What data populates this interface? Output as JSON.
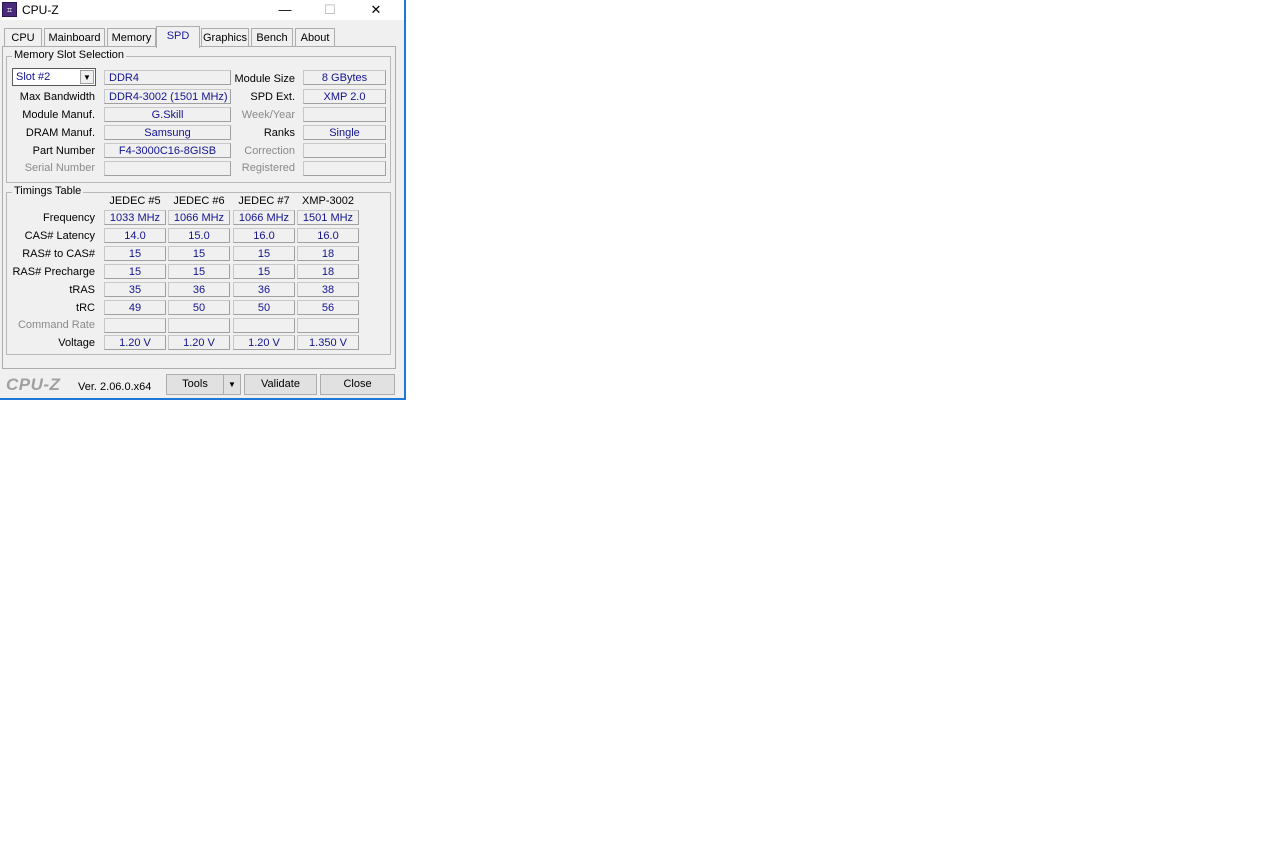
{
  "window": {
    "title": "CPU-Z",
    "icon_label": "⌗",
    "minimize": "—",
    "maximize": "☐",
    "close": "✕"
  },
  "tabs": [
    {
      "label": "CPU",
      "active": false
    },
    {
      "label": "Mainboard",
      "active": false
    },
    {
      "label": "Memory",
      "active": false
    },
    {
      "label": "SPD",
      "active": true
    },
    {
      "label": "Graphics",
      "active": false
    },
    {
      "label": "Bench",
      "active": false
    },
    {
      "label": "About",
      "active": false
    }
  ],
  "memory_slot": {
    "group_title": "Memory Slot Selection",
    "slot": "Slot #2",
    "type": "DDR4",
    "labels": {
      "max_bandwidth": "Max Bandwidth",
      "module_manuf": "Module Manuf.",
      "dram_manuf": "DRAM Manuf.",
      "part_number": "Part Number",
      "serial_number": "Serial Number",
      "module_size": "Module Size",
      "spd_ext": "SPD Ext.",
      "week_year": "Week/Year",
      "ranks": "Ranks",
      "correction": "Correction",
      "registered": "Registered"
    },
    "values": {
      "max_bandwidth": "DDR4-3002 (1501 MHz)",
      "module_manuf": "G.Skill",
      "dram_manuf": "Samsung",
      "part_number": "F4-3000C16-8GISB",
      "serial_number": "",
      "module_size": "8 GBytes",
      "spd_ext": "XMP 2.0",
      "week_year": "",
      "ranks": "Single",
      "correction": "",
      "registered": ""
    }
  },
  "timings": {
    "group_title": "Timings Table",
    "columns": [
      "JEDEC #5",
      "JEDEC #6",
      "JEDEC #7",
      "XMP-3002"
    ],
    "rows": [
      {
        "label": "Frequency",
        "disabled": false,
        "values": [
          "1033 MHz",
          "1066 MHz",
          "1066 MHz",
          "1501 MHz"
        ]
      },
      {
        "label": "CAS# Latency",
        "disabled": false,
        "values": [
          "14.0",
          "15.0",
          "16.0",
          "16.0"
        ]
      },
      {
        "label": "RAS# to CAS#",
        "disabled": false,
        "values": [
          "15",
          "15",
          "15",
          "18"
        ]
      },
      {
        "label": "RAS# Precharge",
        "disabled": false,
        "values": [
          "15",
          "15",
          "15",
          "18"
        ]
      },
      {
        "label": "tRAS",
        "disabled": false,
        "values": [
          "35",
          "36",
          "36",
          "38"
        ]
      },
      {
        "label": "tRC",
        "disabled": false,
        "values": [
          "49",
          "50",
          "50",
          "56"
        ]
      },
      {
        "label": "Command Rate",
        "disabled": true,
        "values": [
          "",
          "",
          "",
          ""
        ]
      },
      {
        "label": "Voltage",
        "disabled": false,
        "values": [
          "1.20 V",
          "1.20 V",
          "1.20 V",
          "1.350 V"
        ]
      }
    ]
  },
  "footer": {
    "logo": "CPU-Z",
    "version": "Ver. 2.06.0.x64",
    "tools_label": "Tools",
    "tools_arrow": "▼",
    "validate_label": "Validate",
    "close_label": "Close"
  }
}
